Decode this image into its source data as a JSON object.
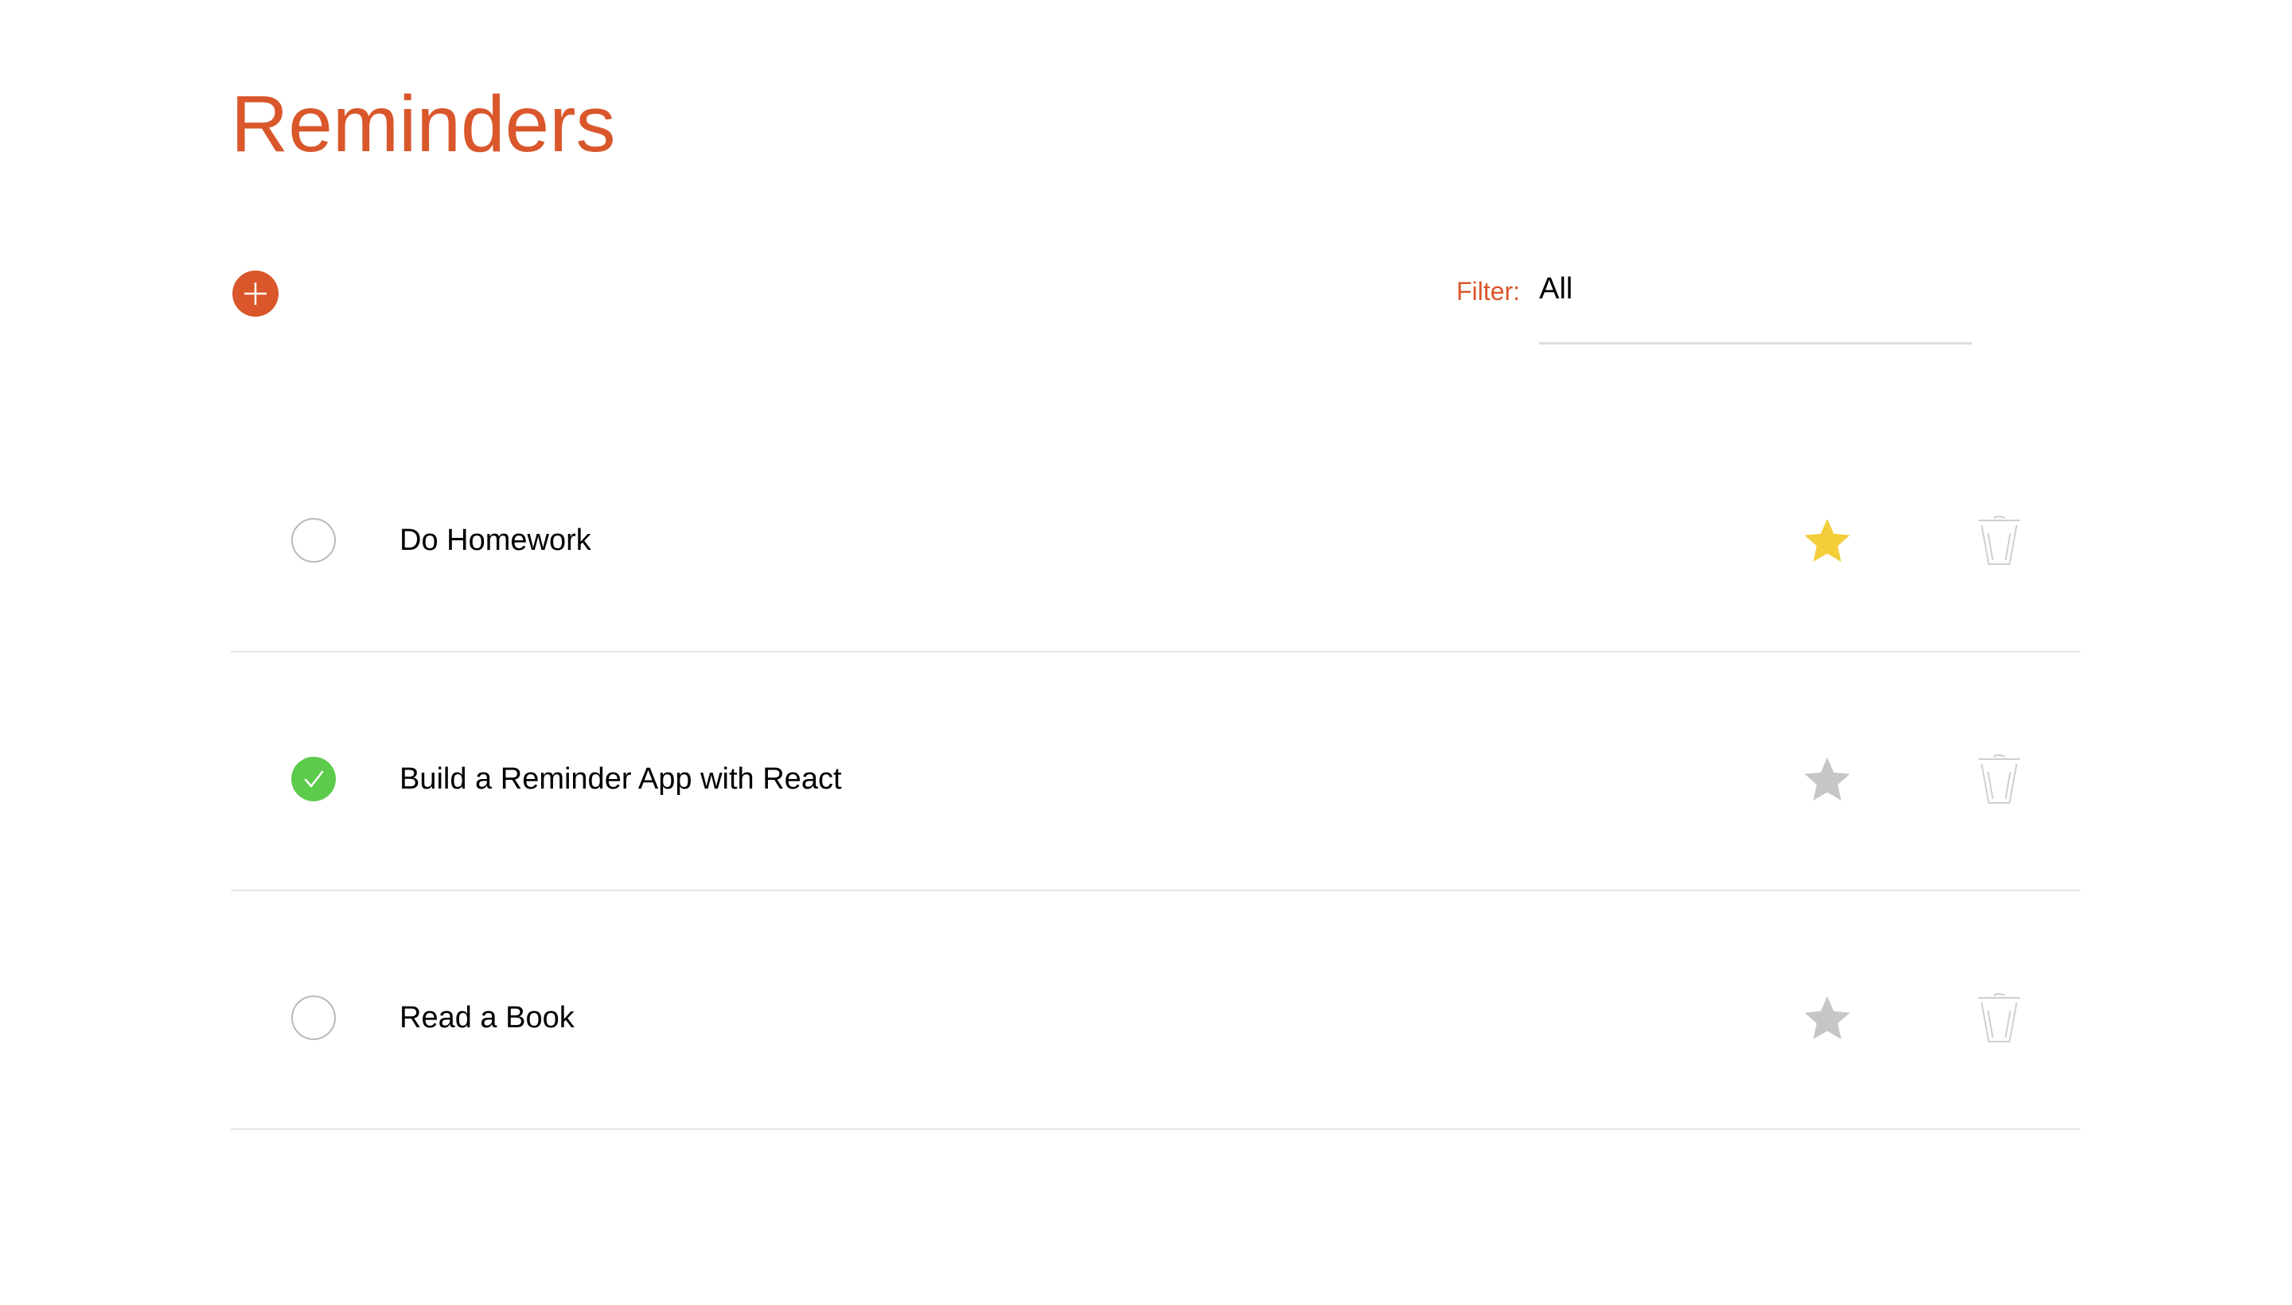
{
  "header": {
    "title": "Reminders"
  },
  "toolbar": {
    "add_icon": "plus-icon",
    "filter_label": "Filter:",
    "filter_value": "All"
  },
  "colors": {
    "accent": "#d9572b",
    "done": "#5ccb4c",
    "star_active": "#f3cd3a",
    "star_inactive": "#c6c6c6",
    "trash": "#cfcfcf"
  },
  "reminders": [
    {
      "text": "Do Homework",
      "completed": false,
      "starred": true
    },
    {
      "text": "Build a Reminder App with React",
      "completed": true,
      "starred": false
    },
    {
      "text": "Read a Book",
      "completed": false,
      "starred": false
    }
  ]
}
